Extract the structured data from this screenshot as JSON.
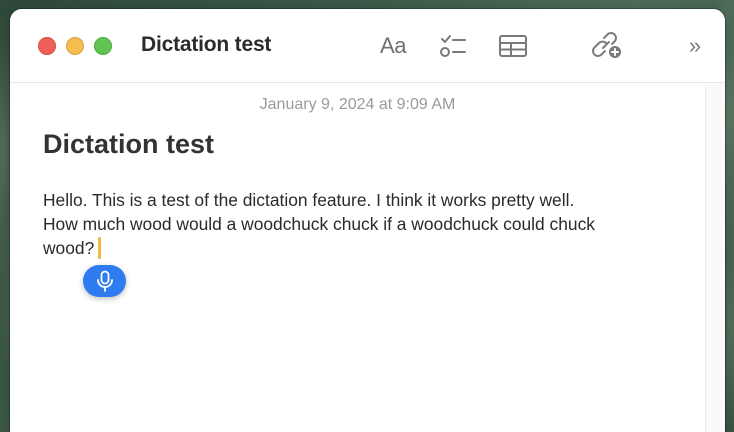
{
  "window": {
    "title": "Dictation test"
  },
  "toolbar": {
    "format_label": "Aa",
    "icons": [
      "format-icon",
      "checklist-icon",
      "table-icon",
      "collaborate-icon",
      "more-chevron-icon"
    ],
    "more_label": "»"
  },
  "note": {
    "date": "January 9, 2024 at 9:09 AM",
    "heading": "Dictation test",
    "body_lines": [
      "Hello. This is a test of the dictation feature. I think it works pretty well.",
      "How much wood would a woodchuck chuck if a woodchuck could chuck",
      "wood?"
    ]
  },
  "dictation": {
    "icon": "microphone-icon",
    "caret_color": "#f5b73d",
    "button_color": "#2f7cf0"
  },
  "colors": {
    "close": "#ee5f58",
    "minimize": "#f5bd4f",
    "maximize": "#5fc454"
  }
}
